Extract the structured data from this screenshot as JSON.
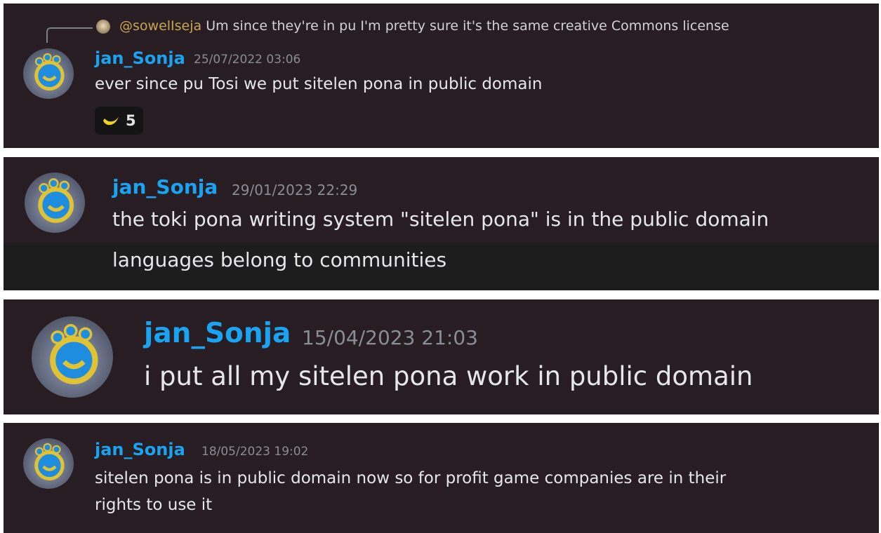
{
  "colors": {
    "panel_bg": "#271d23",
    "stripe_bg": "#1d1d1d",
    "username": "#1aa3f0",
    "timestamp": "#8a8d93",
    "message": "#e6e7ea",
    "mention": "#c9a552"
  },
  "icons": {
    "avatar": "blue-yellow-face-avatar-icon",
    "reaction": "yellow-banana-emoji-icon"
  },
  "messages": [
    {
      "reply": {
        "mention": "@sowelIseja",
        "text": " Um since they're in pu I'm pretty sure it's the same creative Commons license"
      },
      "username": "jan_Sonja",
      "timestamp": "25/07/2022 03:06",
      "lines": [
        "ever since pu Tosi we put sitelen pona in public domain"
      ],
      "reaction": {
        "count": "5"
      }
    },
    {
      "username": "jan_Sonja",
      "timestamp": "29/01/2023 22:29",
      "lines": [
        "the toki pona writing system \"sitelen pona\" is in the public domain",
        "languages belong to communities"
      ]
    },
    {
      "username": "jan_Sonja",
      "timestamp": "15/04/2023 21:03",
      "lines": [
        "i put all my sitelen pona work in public domain"
      ]
    },
    {
      "username": "jan_Sonja",
      "timestamp": "18/05/2023 19:02",
      "lines": [
        "sitelen pona is in public domain now so for profit game companies are in their",
        "rights to use it"
      ]
    }
  ]
}
